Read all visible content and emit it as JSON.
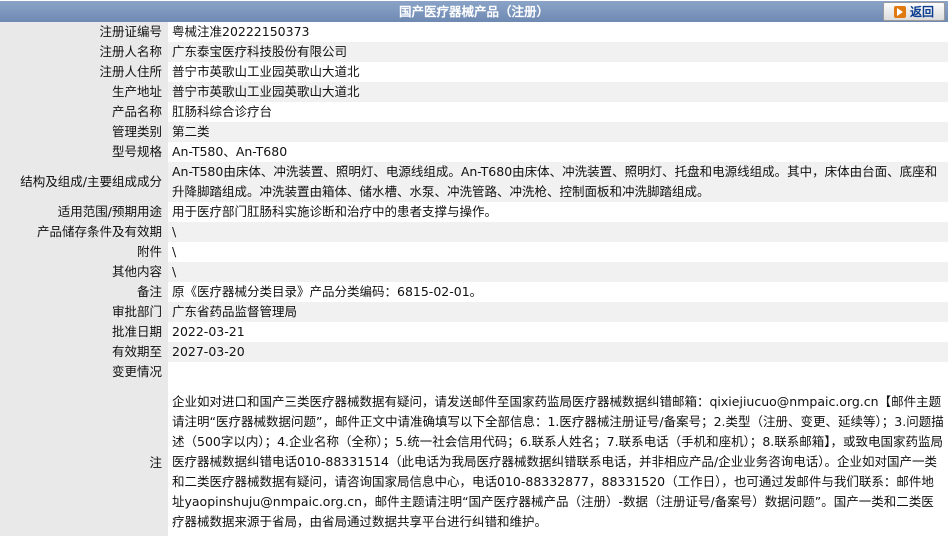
{
  "header": {
    "title": "国产医疗器械产品（注册）",
    "back_label": "返回"
  },
  "rows": [
    {
      "label": "注册证编号",
      "value": "粤械注准20222150373"
    },
    {
      "label": "注册人名称",
      "value": "广东泰宝医疗科技股份有限公司"
    },
    {
      "label": "注册人住所",
      "value": "普宁市英歌山工业园英歌山大道北"
    },
    {
      "label": "生产地址",
      "value": "普宁市英歌山工业园英歌山大道北"
    },
    {
      "label": "产品名称",
      "value": "肛肠科综合诊疗台"
    },
    {
      "label": "管理类别",
      "value": "第二类"
    },
    {
      "label": "型号规格",
      "value": "An-T580、An-T680"
    },
    {
      "label": "结构及组成/主要组成成分",
      "value": "An-T580由床体、冲洗装置、照明灯、电源线组成。An-T680由床体、冲洗装置、照明灯、托盘和电源线组成。其中，床体由台面、底座和升降脚踏组成。冲洗装置由箱体、储水槽、水泵、冲洗管路、冲洗枪、控制面板和冲洗脚踏组成。"
    },
    {
      "label": "适用范围/预期用途",
      "value": "用于医疗部门肛肠科实施诊断和治疗中的患者支撑与操作。"
    },
    {
      "label": "产品储存条件及有效期",
      "value": "\\"
    },
    {
      "label": "附件",
      "value": "\\"
    },
    {
      "label": "其他内容",
      "value": "\\"
    },
    {
      "label": "备注",
      "value": "原《医疗器械分类目录》产品分类编码：6815-02-01。"
    },
    {
      "label": "审批部门",
      "value": "广东省药品监督管理局"
    },
    {
      "label": "批准日期",
      "value": "2022-03-21"
    },
    {
      "label": "有效期至",
      "value": "2027-03-20"
    },
    {
      "label": "变更情况",
      "value": ""
    }
  ],
  "note": {
    "label": "注",
    "text": "企业如对进口和国产三类医疗器械数据有疑问，请发送邮件至国家药监局医疗器械数据纠错邮箱：qixiejiucuo@nmpaic.org.cn【邮件主题请注明“医疗器械数据问题”，邮件正文中请准确填写以下全部信息：1.医疗器械注册证号/备案号；2.类型（注册、变更、延续等）；3.问题描述（500字以内）；4.企业名称（全称）；5.统一社会信用代码；6.联系人姓名；7.联系电话（手机和座机）；8.联系邮箱】，或致电国家药监局医疗器械数据纠错电话010-88331514（此电话为我局医疗器械数据纠错联系电话，并非相应产品/企业业务咨询电话）。企业如对国产一类和二类医疗器械数据有疑问，请咨询国家局信息中心，电话010-88332877，88331520（工作日），也可通过发邮件与我们联系：邮件地址yaopinshuju@nmpaic.org.cn，邮件主题请注明“国产医疗器械产品（注册）-数据（注册证号/备案号）数据问题”。国产一类和二类医疗器械数据来源于省局，由省局通过数据共享平台进行纠错和维护。"
  }
}
